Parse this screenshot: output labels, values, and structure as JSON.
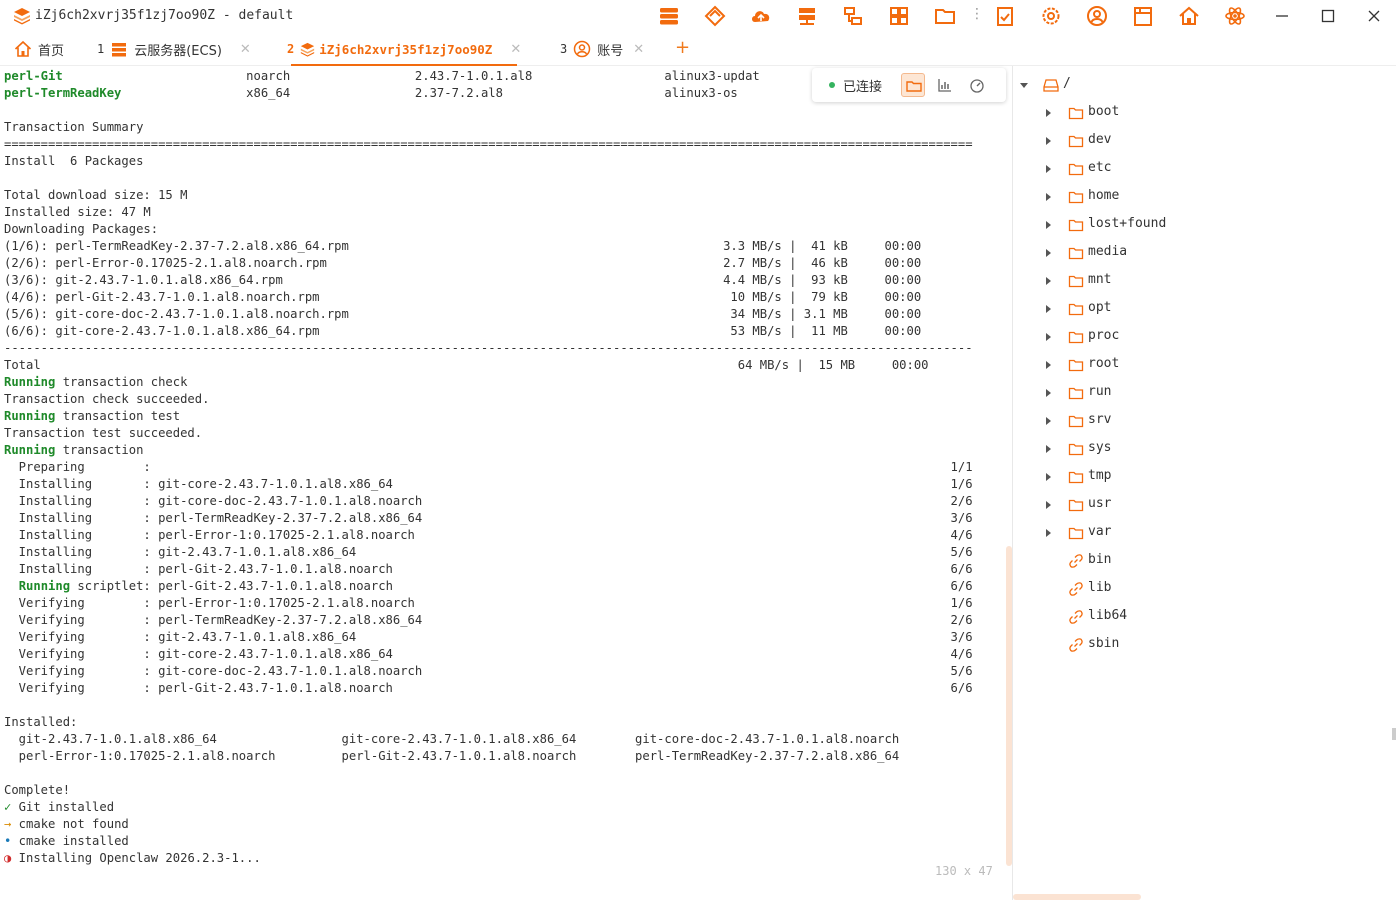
{
  "window": {
    "title": "iZj6ch2xvrj35f1zj7oo90Z - default",
    "toolbar_icons": [
      "database-icon",
      "layers-icon",
      "cloud-icon",
      "server-icon",
      "network-icon",
      "grid-icon",
      "folder-icon",
      "clipboard-check-icon",
      "gear-icon",
      "user-icon",
      "book-icon",
      "home-icon",
      "atom-icon"
    ],
    "controls": [
      "minimize-icon",
      "maximize-icon",
      "close-icon"
    ]
  },
  "tabs": [
    {
      "num": "",
      "label": "首页",
      "icon": "home-icon",
      "active": false
    },
    {
      "num": "1",
      "label": "云服务器(ECS)",
      "icon": "server-icon",
      "active": false
    },
    {
      "num": "2",
      "label": "iZj6ch2xvrj35f1zj7oo90Z",
      "icon": "layers-icon",
      "active": true
    },
    {
      "num": "3",
      "label": "账号",
      "icon": "user-icon",
      "active": false
    }
  ],
  "add_tab": "+",
  "connection": {
    "status": "已连接",
    "buttons": [
      "folder-icon",
      "chart-icon",
      "gauge-icon"
    ]
  },
  "terminal": {
    "lines": [
      [
        {
          "t": "perl-Git                         ",
          "c": "pkg"
        },
        {
          "t": "noarch                 2.43.7-1.0.1.al8                  alinux3-updat"
        }
      ],
      [
        {
          "t": "perl-TermReadKey                 ",
          "c": "pkg"
        },
        {
          "t": "x86_64                 2.37-7.2.al8                      alinux3-os"
        }
      ],
      [
        {
          "t": ""
        }
      ],
      [
        {
          "t": "Transaction Summary"
        }
      ],
      [
        {
          "t": "===================================================================================================================================="
        }
      ],
      [
        {
          "t": "Install  6 Packages"
        }
      ],
      [
        {
          "t": ""
        }
      ],
      [
        {
          "t": "Total download size: 15 M"
        }
      ],
      [
        {
          "t": "Installed size: 47 M"
        }
      ],
      [
        {
          "t": "Downloading Packages:"
        }
      ],
      [
        {
          "t": "(1/6): perl-TermReadKey-2.37-7.2.al8.x86_64.rpm                                                   3.3 MB/s |  41 kB     00:00"
        }
      ],
      [
        {
          "t": "(2/6): perl-Error-0.17025-2.1.al8.noarch.rpm                                                      2.7 MB/s |  46 kB     00:00"
        }
      ],
      [
        {
          "t": "(3/6): git-2.43.7-1.0.1.al8.x86_64.rpm                                                            4.4 MB/s |  93 kB     00:00"
        }
      ],
      [
        {
          "t": "(4/6): perl-Git-2.43.7-1.0.1.al8.noarch.rpm                                                        10 MB/s |  79 kB     00:00"
        }
      ],
      [
        {
          "t": "(5/6): git-core-doc-2.43.7-1.0.1.al8.noarch.rpm                                                    34 MB/s | 3.1 MB     00:00"
        }
      ],
      [
        {
          "t": "(6/6): git-core-2.43.7-1.0.1.al8.x86_64.rpm                                                        53 MB/s |  11 MB     00:00"
        }
      ],
      [
        {
          "t": "------------------------------------------------------------------------------------------------------------------------------------"
        }
      ],
      [
        {
          "t": "Total                                                                                               64 MB/s |  15 MB     00:00"
        }
      ],
      [
        {
          "t": "Running",
          "c": "kw"
        },
        {
          "t": " transaction check"
        }
      ],
      [
        {
          "t": "Transaction check succeeded."
        }
      ],
      [
        {
          "t": "Running",
          "c": "kw"
        },
        {
          "t": " transaction test"
        }
      ],
      [
        {
          "t": "Transaction test succeeded."
        }
      ],
      [
        {
          "t": "Running",
          "c": "kw"
        },
        {
          "t": " transaction"
        }
      ],
      [
        {
          "t": "  Preparing        :                                                                                                             1/1"
        }
      ],
      [
        {
          "t": "  Installing       : git-core-2.43.7-1.0.1.al8.x86_64                                                                            1/6"
        }
      ],
      [
        {
          "t": "  Installing       : git-core-doc-2.43.7-1.0.1.al8.noarch                                                                        2/6"
        }
      ],
      [
        {
          "t": "  Installing       : perl-TermReadKey-2.37-7.2.al8.x86_64                                                                        3/6"
        }
      ],
      [
        {
          "t": "  Installing       : perl-Error-1:0.17025-2.1.al8.noarch                                                                         4/6"
        }
      ],
      [
        {
          "t": "  Installing       : git-2.43.7-1.0.1.al8.x86_64                                                                                 5/6"
        }
      ],
      [
        {
          "t": "  Installing       : perl-Git-2.43.7-1.0.1.al8.noarch                                                                            6/6"
        }
      ],
      [
        {
          "t": "  "
        },
        {
          "t": "Running",
          "c": "kw"
        },
        {
          "t": " scriptlet: perl-Git-2.43.7-1.0.1.al8.noarch                                                                            6/6"
        }
      ],
      [
        {
          "t": "  Verifying        : perl-Error-1:0.17025-2.1.al8.noarch                                                                         1/6"
        }
      ],
      [
        {
          "t": "  Verifying        : perl-TermReadKey-2.37-7.2.al8.x86_64                                                                        2/6"
        }
      ],
      [
        {
          "t": "  Verifying        : git-2.43.7-1.0.1.al8.x86_64                                                                                 3/6"
        }
      ],
      [
        {
          "t": "  Verifying        : git-core-2.43.7-1.0.1.al8.x86_64                                                                            4/6"
        }
      ],
      [
        {
          "t": "  Verifying        : git-core-doc-2.43.7-1.0.1.al8.noarch                                                                        5/6"
        }
      ],
      [
        {
          "t": "  Verifying        : perl-Git-2.43.7-1.0.1.al8.noarch                                                                            6/6"
        }
      ],
      [
        {
          "t": ""
        }
      ],
      [
        {
          "t": "Installed:"
        }
      ],
      [
        {
          "t": "  git-2.43.7-1.0.1.al8.x86_64                 git-core-2.43.7-1.0.1.al8.x86_64        git-core-doc-2.43.7-1.0.1.al8.noarch"
        }
      ],
      [
        {
          "t": "  perl-Error-1:0.17025-2.1.al8.noarch         perl-Git-2.43.7-1.0.1.al8.noarch        perl-TermReadKey-2.37-7.2.al8.x86_64"
        }
      ],
      [
        {
          "t": ""
        }
      ],
      [
        {
          "t": "Complete!"
        }
      ],
      [
        {
          "t": "✓",
          "c": "ok"
        },
        {
          "t": " Git installed"
        }
      ],
      [
        {
          "t": "→",
          "c": "warn"
        },
        {
          "t": " cmake not found"
        }
      ],
      [
        {
          "t": "•",
          "c": "info"
        },
        {
          "t": " cmake installed"
        }
      ],
      [
        {
          "t": "◑",
          "c": "spin"
        },
        {
          "t": " Installing Openclaw 2026.2.3-1..."
        }
      ]
    ],
    "size": "130 x 47"
  },
  "filetree": {
    "root": "/",
    "folders": [
      "boot",
      "dev",
      "etc",
      "home",
      "lost+found",
      "media",
      "mnt",
      "opt",
      "proc",
      "root",
      "run",
      "srv",
      "sys",
      "tmp",
      "usr",
      "var"
    ],
    "links": [
      "bin",
      "lib",
      "lib64",
      "sbin"
    ]
  },
  "colors": {
    "accent": "#f26b0e",
    "connected": "#35b35f",
    "keyword": "#1f8a2a"
  }
}
